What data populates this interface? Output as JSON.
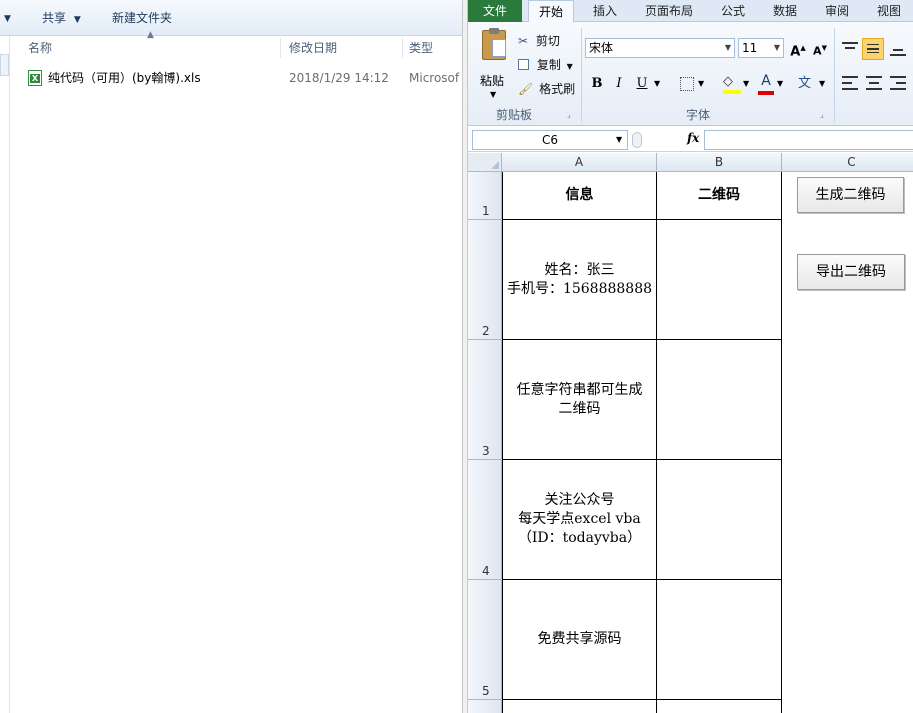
{
  "explorer": {
    "toolbar": {
      "share_label": "共享",
      "new_folder_label": "新建文件夹"
    },
    "columns": {
      "name": "名称",
      "modified": "修改日期",
      "type": "类型"
    },
    "file": {
      "name": "纯代码（可用）(by翰博).xls",
      "modified": "2018/1/29 14:12",
      "type": "Microsof"
    }
  },
  "excel": {
    "tabs": {
      "file": "文件",
      "home": "开始",
      "insert": "插入",
      "page_layout": "页面布局",
      "formulas": "公式",
      "data": "数据",
      "review": "审阅",
      "view": "视图"
    },
    "clipboard": {
      "paste": "粘贴",
      "cut": "剪切",
      "copy": "复制",
      "format_painter": "格式刷",
      "group_label": "剪贴板"
    },
    "font": {
      "name": "宋体",
      "size": "11",
      "group_label": "字体",
      "bold": "B",
      "italic": "I",
      "underline": "U"
    },
    "name_box": "C6",
    "fx": "fx",
    "columns": [
      "A",
      "B",
      "C"
    ],
    "rows": [
      "1",
      "2",
      "3",
      "4",
      "5"
    ],
    "cells": {
      "a1": "信息",
      "b1": "二维码",
      "a2": "姓名：张三\n手机号：1568888888",
      "a3": "任意字符串都可生成\n二维码",
      "a4": "关注公众号\n每天学点excel vba\n（ID：todayvba）",
      "a5": "免费共享源码"
    },
    "buttons": {
      "generate": "生成二维码",
      "export": "导出二维码"
    }
  },
  "colors": {
    "file_tab": "#2a7a3b",
    "ribbon": "#dfe9f5"
  }
}
